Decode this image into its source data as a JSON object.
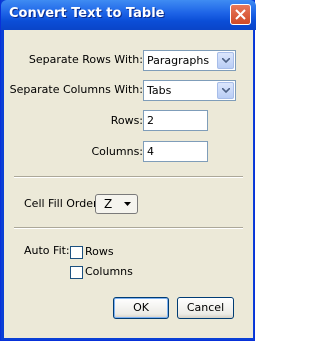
{
  "window": {
    "title": "Convert Text to Table"
  },
  "fields": {
    "separate_rows_label": "Separate Rows With:",
    "separate_rows_value": "Paragraphs",
    "separate_columns_label": "Separate Columns With:",
    "separate_columns_value": "Tabs",
    "rows_label": "Rows:",
    "rows_value": "2",
    "columns_label": "Columns:",
    "columns_value": "4",
    "cell_fill_order_label": "Cell Fill Order:",
    "cell_fill_order_value": "Z",
    "auto_fit_label": "Auto Fit:",
    "auto_fit_rows_label": "Rows",
    "auto_fit_columns_label": "Columns"
  },
  "buttons": {
    "ok": "OK",
    "cancel": "Cancel"
  },
  "colors": {
    "titlebar": "#1c62e6",
    "close_button": "#d04a26",
    "dialog_face": "#ece9d8",
    "field_border": "#7f9db9"
  }
}
